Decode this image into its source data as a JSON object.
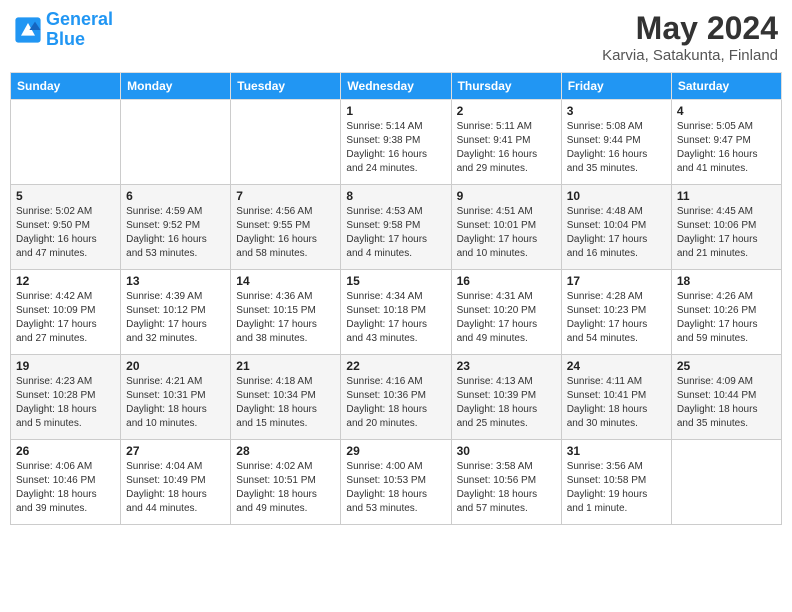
{
  "logo": {
    "line1": "General",
    "line2": "Blue"
  },
  "title": {
    "month_year": "May 2024",
    "location": "Karvia, Satakunta, Finland"
  },
  "weekdays": [
    "Sunday",
    "Monday",
    "Tuesday",
    "Wednesday",
    "Thursday",
    "Friday",
    "Saturday"
  ],
  "weeks": [
    [
      {
        "day": "",
        "sunrise": "",
        "sunset": "",
        "daylight": ""
      },
      {
        "day": "",
        "sunrise": "",
        "sunset": "",
        "daylight": ""
      },
      {
        "day": "",
        "sunrise": "",
        "sunset": "",
        "daylight": ""
      },
      {
        "day": "1",
        "sunrise": "Sunrise: 5:14 AM",
        "sunset": "Sunset: 9:38 PM",
        "daylight": "Daylight: 16 hours and 24 minutes."
      },
      {
        "day": "2",
        "sunrise": "Sunrise: 5:11 AM",
        "sunset": "Sunset: 9:41 PM",
        "daylight": "Daylight: 16 hours and 29 minutes."
      },
      {
        "day": "3",
        "sunrise": "Sunrise: 5:08 AM",
        "sunset": "Sunset: 9:44 PM",
        "daylight": "Daylight: 16 hours and 35 minutes."
      },
      {
        "day": "4",
        "sunrise": "Sunrise: 5:05 AM",
        "sunset": "Sunset: 9:47 PM",
        "daylight": "Daylight: 16 hours and 41 minutes."
      }
    ],
    [
      {
        "day": "5",
        "sunrise": "Sunrise: 5:02 AM",
        "sunset": "Sunset: 9:50 PM",
        "daylight": "Daylight: 16 hours and 47 minutes."
      },
      {
        "day": "6",
        "sunrise": "Sunrise: 4:59 AM",
        "sunset": "Sunset: 9:52 PM",
        "daylight": "Daylight: 16 hours and 53 minutes."
      },
      {
        "day": "7",
        "sunrise": "Sunrise: 4:56 AM",
        "sunset": "Sunset: 9:55 PM",
        "daylight": "Daylight: 16 hours and 58 minutes."
      },
      {
        "day": "8",
        "sunrise": "Sunrise: 4:53 AM",
        "sunset": "Sunset: 9:58 PM",
        "daylight": "Daylight: 17 hours and 4 minutes."
      },
      {
        "day": "9",
        "sunrise": "Sunrise: 4:51 AM",
        "sunset": "Sunset: 10:01 PM",
        "daylight": "Daylight: 17 hours and 10 minutes."
      },
      {
        "day": "10",
        "sunrise": "Sunrise: 4:48 AM",
        "sunset": "Sunset: 10:04 PM",
        "daylight": "Daylight: 17 hours and 16 minutes."
      },
      {
        "day": "11",
        "sunrise": "Sunrise: 4:45 AM",
        "sunset": "Sunset: 10:06 PM",
        "daylight": "Daylight: 17 hours and 21 minutes."
      }
    ],
    [
      {
        "day": "12",
        "sunrise": "Sunrise: 4:42 AM",
        "sunset": "Sunset: 10:09 PM",
        "daylight": "Daylight: 17 hours and 27 minutes."
      },
      {
        "day": "13",
        "sunrise": "Sunrise: 4:39 AM",
        "sunset": "Sunset: 10:12 PM",
        "daylight": "Daylight: 17 hours and 32 minutes."
      },
      {
        "day": "14",
        "sunrise": "Sunrise: 4:36 AM",
        "sunset": "Sunset: 10:15 PM",
        "daylight": "Daylight: 17 hours and 38 minutes."
      },
      {
        "day": "15",
        "sunrise": "Sunrise: 4:34 AM",
        "sunset": "Sunset: 10:18 PM",
        "daylight": "Daylight: 17 hours and 43 minutes."
      },
      {
        "day": "16",
        "sunrise": "Sunrise: 4:31 AM",
        "sunset": "Sunset: 10:20 PM",
        "daylight": "Daylight: 17 hours and 49 minutes."
      },
      {
        "day": "17",
        "sunrise": "Sunrise: 4:28 AM",
        "sunset": "Sunset: 10:23 PM",
        "daylight": "Daylight: 17 hours and 54 minutes."
      },
      {
        "day": "18",
        "sunrise": "Sunrise: 4:26 AM",
        "sunset": "Sunset: 10:26 PM",
        "daylight": "Daylight: 17 hours and 59 minutes."
      }
    ],
    [
      {
        "day": "19",
        "sunrise": "Sunrise: 4:23 AM",
        "sunset": "Sunset: 10:28 PM",
        "daylight": "Daylight: 18 hours and 5 minutes."
      },
      {
        "day": "20",
        "sunrise": "Sunrise: 4:21 AM",
        "sunset": "Sunset: 10:31 PM",
        "daylight": "Daylight: 18 hours and 10 minutes."
      },
      {
        "day": "21",
        "sunrise": "Sunrise: 4:18 AM",
        "sunset": "Sunset: 10:34 PM",
        "daylight": "Daylight: 18 hours and 15 minutes."
      },
      {
        "day": "22",
        "sunrise": "Sunrise: 4:16 AM",
        "sunset": "Sunset: 10:36 PM",
        "daylight": "Daylight: 18 hours and 20 minutes."
      },
      {
        "day": "23",
        "sunrise": "Sunrise: 4:13 AM",
        "sunset": "Sunset: 10:39 PM",
        "daylight": "Daylight: 18 hours and 25 minutes."
      },
      {
        "day": "24",
        "sunrise": "Sunrise: 4:11 AM",
        "sunset": "Sunset: 10:41 PM",
        "daylight": "Daylight: 18 hours and 30 minutes."
      },
      {
        "day": "25",
        "sunrise": "Sunrise: 4:09 AM",
        "sunset": "Sunset: 10:44 PM",
        "daylight": "Daylight: 18 hours and 35 minutes."
      }
    ],
    [
      {
        "day": "26",
        "sunrise": "Sunrise: 4:06 AM",
        "sunset": "Sunset: 10:46 PM",
        "daylight": "Daylight: 18 hours and 39 minutes."
      },
      {
        "day": "27",
        "sunrise": "Sunrise: 4:04 AM",
        "sunset": "Sunset: 10:49 PM",
        "daylight": "Daylight: 18 hours and 44 minutes."
      },
      {
        "day": "28",
        "sunrise": "Sunrise: 4:02 AM",
        "sunset": "Sunset: 10:51 PM",
        "daylight": "Daylight: 18 hours and 49 minutes."
      },
      {
        "day": "29",
        "sunrise": "Sunrise: 4:00 AM",
        "sunset": "Sunset: 10:53 PM",
        "daylight": "Daylight: 18 hours and 53 minutes."
      },
      {
        "day": "30",
        "sunrise": "Sunrise: 3:58 AM",
        "sunset": "Sunset: 10:56 PM",
        "daylight": "Daylight: 18 hours and 57 minutes."
      },
      {
        "day": "31",
        "sunrise": "Sunrise: 3:56 AM",
        "sunset": "Sunset: 10:58 PM",
        "daylight": "Daylight: 19 hours and 1 minute."
      },
      {
        "day": "",
        "sunrise": "",
        "sunset": "",
        "daylight": ""
      }
    ]
  ]
}
